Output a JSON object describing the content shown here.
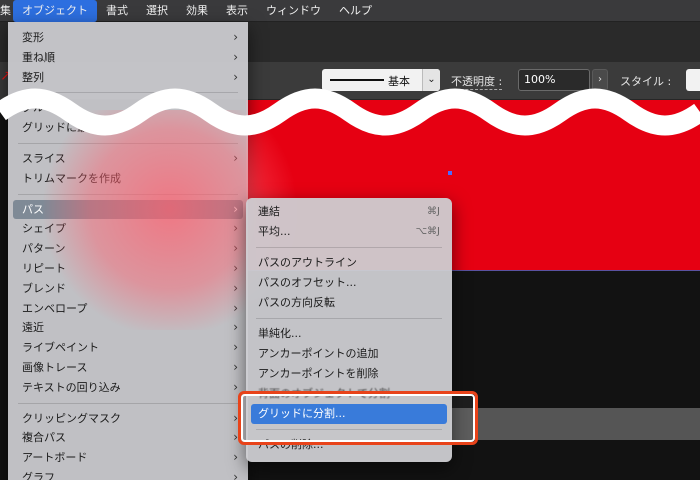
{
  "menubar": {
    "items": [
      {
        "label": "集",
        "active": false,
        "cut": true
      },
      {
        "label": "オブジェクト",
        "active": true
      },
      {
        "label": "書式"
      },
      {
        "label": "選択"
      },
      {
        "label": "効果"
      },
      {
        "label": "表示"
      },
      {
        "label": "ウィンドウ"
      },
      {
        "label": "ヘルプ"
      }
    ]
  },
  "controlbar": {
    "stroke_profile": "基本",
    "opacity_label": "不透明度 :",
    "opacity_value": "100%",
    "style_label": "スタイル :"
  },
  "object_menu": {
    "items": [
      {
        "label": "変形",
        "submenu": true
      },
      {
        "label": "重ね順",
        "submenu": true
      },
      {
        "label": "整列",
        "submenu": true
      },
      {
        "sep": true
      },
      {
        "label": "グループ",
        "submenu": false
      },
      {
        "label": "グリッドに最適化",
        "submenu": false
      },
      {
        "sep": true
      },
      {
        "label": "スライス",
        "submenu": true
      },
      {
        "label": "トリムマークを作成",
        "submenu": false
      },
      {
        "sep": true
      },
      {
        "label": "パス",
        "submenu": true,
        "highlighted": true
      },
      {
        "label": "シェイプ",
        "submenu": true
      },
      {
        "label": "パターン",
        "submenu": true
      },
      {
        "label": "リピート",
        "submenu": true
      },
      {
        "label": "ブレンド",
        "submenu": true
      },
      {
        "label": "エンベロープ",
        "submenu": true
      },
      {
        "label": "遠近",
        "submenu": true
      },
      {
        "label": "ライブペイント",
        "submenu": true
      },
      {
        "label": "画像トレース",
        "submenu": true
      },
      {
        "label": "テキストの回り込み",
        "submenu": true
      },
      {
        "sep": true
      },
      {
        "label": "クリッピングマスク",
        "submenu": true
      },
      {
        "label": "複合パス",
        "submenu": true
      },
      {
        "label": "アートボード",
        "submenu": true
      },
      {
        "label": "グラフ",
        "submenu": true
      }
    ]
  },
  "path_submenu": {
    "items": [
      {
        "label": "連結",
        "shortcut": "⌘J"
      },
      {
        "label": "平均...",
        "shortcut": "⌥⌘J"
      },
      {
        "sep": true
      },
      {
        "label": "パスのアウトライン"
      },
      {
        "label": "パスのオフセット..."
      },
      {
        "label": "パスの方向反転"
      },
      {
        "sep": true
      },
      {
        "label": "単純化..."
      },
      {
        "label": "アンカーポイントの追加"
      },
      {
        "label": "アンカーポイントを削除"
      },
      {
        "label": "背面のオブジェクトで分割",
        "blurred": true
      },
      {
        "label": "グリッドに分割...",
        "selected": true
      },
      {
        "sep": true
      },
      {
        "label": "パスの削除..."
      }
    ]
  },
  "colors": {
    "accent": "#2f74d8",
    "artwork_red": "#e60012",
    "callout": "#e8431a"
  }
}
